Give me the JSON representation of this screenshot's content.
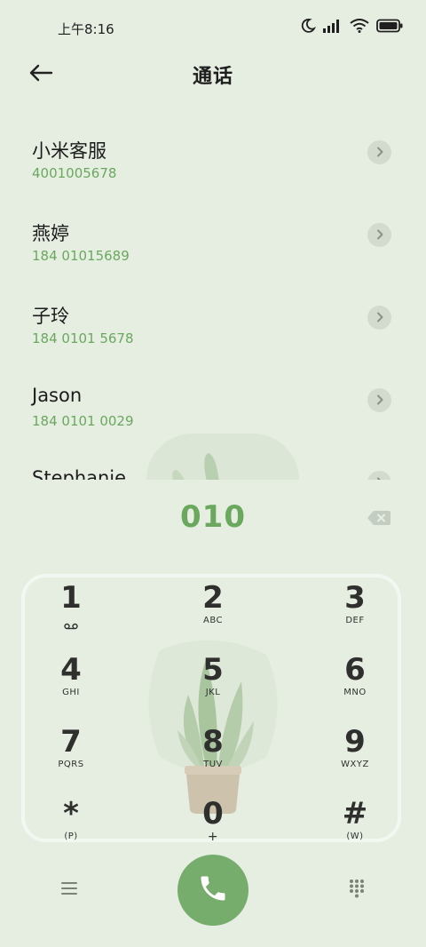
{
  "status_bar": {
    "time": "上午8:16",
    "icons": [
      "moon-icon",
      "signal-icon",
      "wifi-icon",
      "battery-icon"
    ]
  },
  "header": {
    "title": "通话",
    "back_icon": "back-arrow-icon"
  },
  "contacts": [
    {
      "name": "小米客服",
      "number": "4001005678"
    },
    {
      "name": "燕婷",
      "number": "184 01015689"
    },
    {
      "name": "子玲",
      "number": "184 0101 5678"
    },
    {
      "name": "Jason",
      "number": "184 0101 0029"
    },
    {
      "name": "Stephanie",
      "number": ""
    }
  ],
  "entry": {
    "digits": "010",
    "backspace_icon": "backspace-icon"
  },
  "keypad": {
    "keys": [
      {
        "digit": "1",
        "sub": ""
      },
      {
        "digit": "2",
        "sub": "ABC"
      },
      {
        "digit": "3",
        "sub": "DEF"
      },
      {
        "digit": "4",
        "sub": "GHI"
      },
      {
        "digit": "5",
        "sub": "JKL"
      },
      {
        "digit": "6",
        "sub": "MNO"
      },
      {
        "digit": "7",
        "sub": "PQRS"
      },
      {
        "digit": "8",
        "sub": "TUV"
      },
      {
        "digit": "9",
        "sub": "WXYZ"
      },
      {
        "digit": "*",
        "sub": "(P)"
      },
      {
        "digit": "0",
        "sub": "+"
      },
      {
        "digit": "#",
        "sub": "(W)"
      }
    ]
  },
  "colors": {
    "background": "#e6eee2",
    "accent_green": "#6aa85e",
    "call_button": "#77ad6c"
  },
  "bottom_bar": {
    "icons": [
      "menu-icon",
      "phone-icon",
      "dialpad-icon"
    ]
  }
}
